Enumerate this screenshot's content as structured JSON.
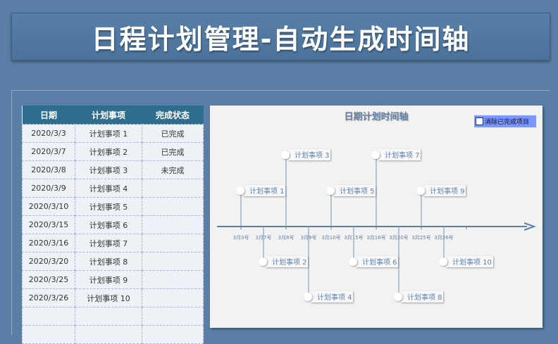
{
  "title": "日程计划管理-自动生成时间轴",
  "table": {
    "headers": [
      "日期",
      "计划事项",
      "完成状态"
    ],
    "rows": [
      [
        "2020/3/3",
        "计划事项 1",
        "已完成"
      ],
      [
        "2020/3/7",
        "计划事项 2",
        "已完成"
      ],
      [
        "2020/3/8",
        "计划事项 3",
        "未完成"
      ],
      [
        "2020/3/9",
        "计划事项 4",
        ""
      ],
      [
        "2020/3/10",
        "计划事项 5",
        ""
      ],
      [
        "2020/3/15",
        "计划事项 6",
        ""
      ],
      [
        "2020/3/16",
        "计划事项 7",
        ""
      ],
      [
        "2020/3/20",
        "计划事项 8",
        ""
      ],
      [
        "2020/3/25",
        "计划事项 9",
        ""
      ],
      [
        "2020/3/26",
        "计划事项 10",
        ""
      ],
      [
        "",
        "",
        ""
      ],
      [
        "",
        "",
        ""
      ]
    ]
  },
  "chart": {
    "title": "日期计划时间轴",
    "filter_label": "消除已完成项目",
    "filter_checked": false
  },
  "colors": {
    "background": "#5a7ea6",
    "header": "#2e6d8e",
    "axis": "#5c7fa8",
    "filter": "#7b96ff"
  },
  "chart_data": {
    "type": "timeline",
    "ticks": [
      "3月3号",
      "3月7号",
      "3月8号",
      "3月9号",
      "3月10号",
      "3月15号",
      "3月16号",
      "3月20号",
      "3月25号",
      "3月26号"
    ],
    "events": [
      {
        "label": "计划事项 1",
        "level": 1
      },
      {
        "label": "计划事项 2",
        "level": -1
      },
      {
        "label": "计划事项 3",
        "level": 2
      },
      {
        "label": "计划事项 4",
        "level": -2
      },
      {
        "label": "计划事项 5",
        "level": 1
      },
      {
        "label": "计划事项 6",
        "level": -1
      },
      {
        "label": "计划事项 7",
        "level": 2
      },
      {
        "label": "计划事项 8",
        "level": -2
      },
      {
        "label": "计划事项 9",
        "level": 1
      },
      {
        "label": "计划事项 10",
        "level": -1
      }
    ]
  }
}
